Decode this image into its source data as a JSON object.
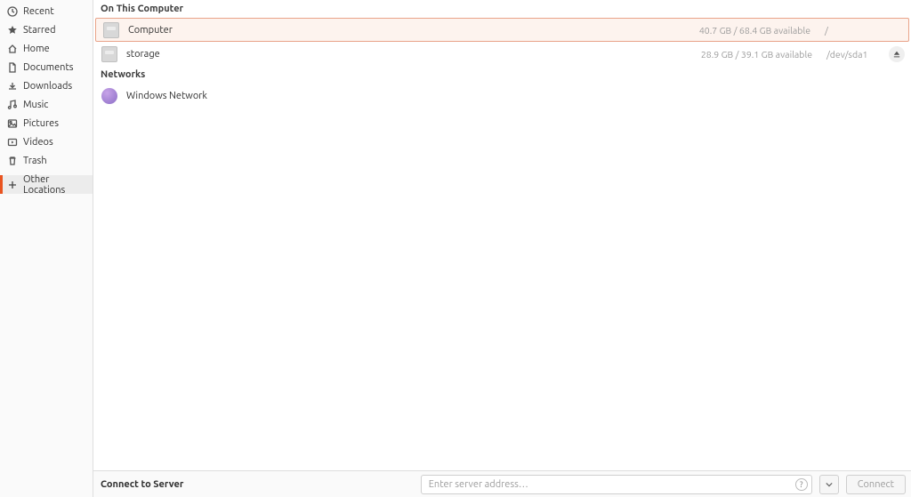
{
  "sidebar": {
    "items": [
      {
        "label": "Recent",
        "icon": "clock-icon"
      },
      {
        "label": "Starred",
        "icon": "star-icon"
      },
      {
        "label": "Home",
        "icon": "home-icon"
      },
      {
        "label": "Documents",
        "icon": "documents-icon"
      },
      {
        "label": "Downloads",
        "icon": "downloads-icon"
      },
      {
        "label": "Music",
        "icon": "music-icon"
      },
      {
        "label": "Pictures",
        "icon": "pictures-icon"
      },
      {
        "label": "Videos",
        "icon": "videos-icon"
      },
      {
        "label": "Trash",
        "icon": "trash-icon"
      },
      {
        "label": "Other Locations",
        "icon": "plus-icon",
        "selected": true
      }
    ]
  },
  "sections": {
    "computer_header": "On This Computer",
    "networks_header": "Networks"
  },
  "locations": {
    "computer": {
      "label": "Computer",
      "meta": "40.7 GB / 68.4 GB available",
      "path": "/"
    },
    "storage": {
      "label": "storage",
      "meta": "28.9 GB / 39.1 GB available",
      "path": "/dev/sda1",
      "ejectable": true
    },
    "windows_network": {
      "label": "Windows Network"
    }
  },
  "bottombar": {
    "title": "Connect to Server",
    "placeholder": "Enter server address…",
    "connect_label": "Connect"
  }
}
